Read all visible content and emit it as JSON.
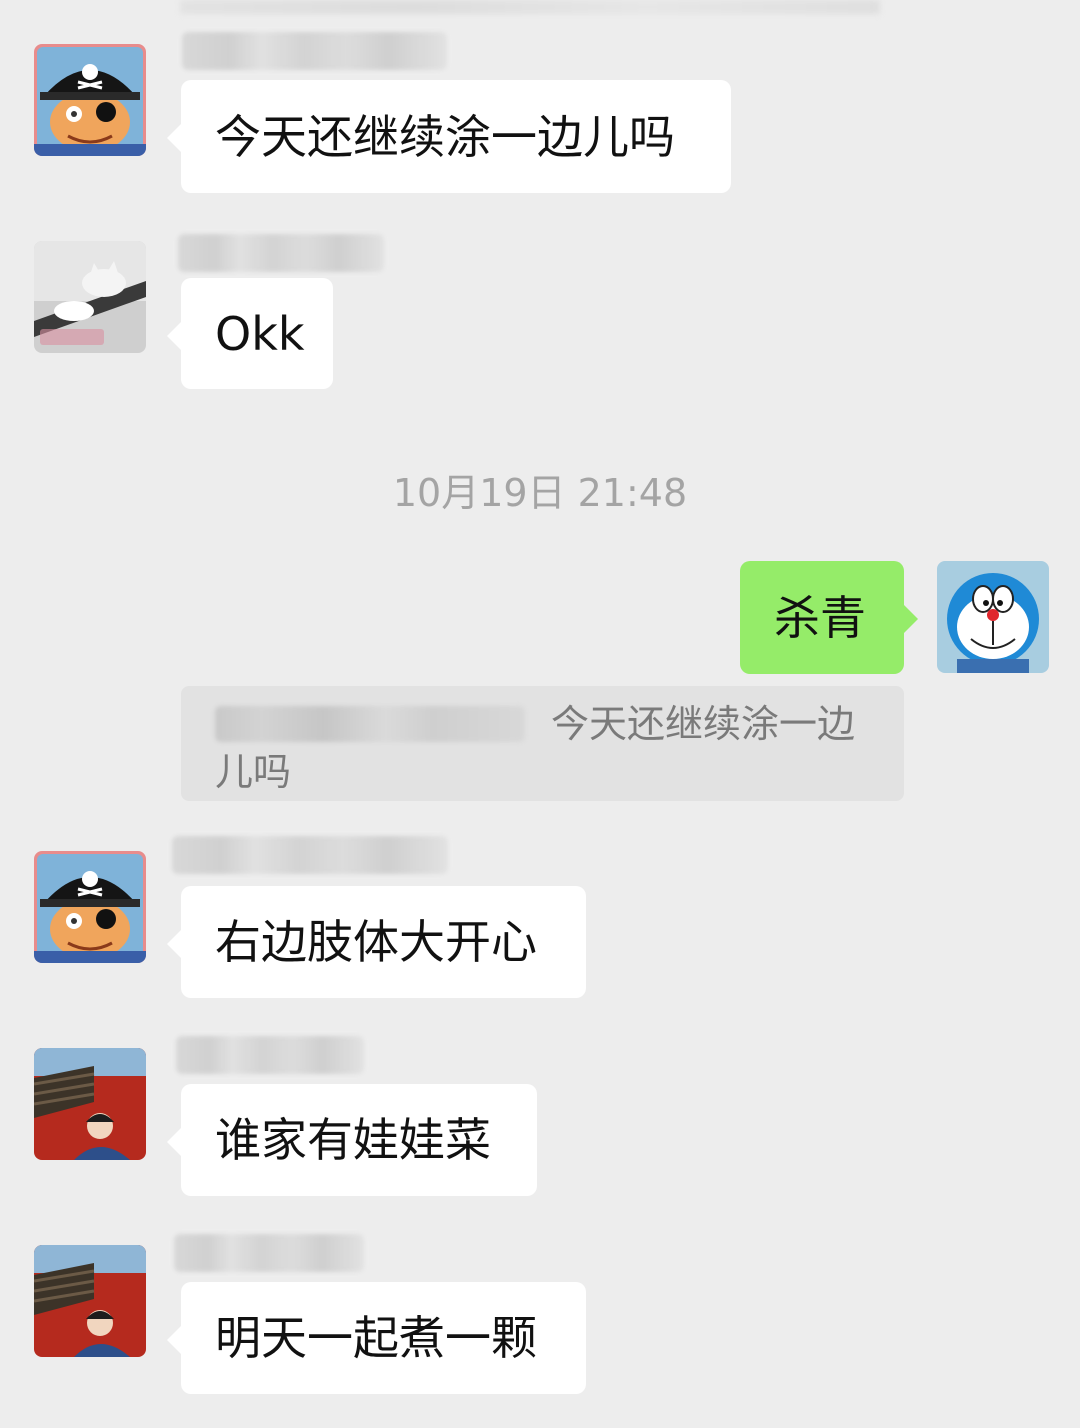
{
  "timestamp": "10月19日 21:48",
  "messages": [
    {
      "text": "今天还继续涂一边儿吗",
      "side": "left",
      "avatar": "pirate-avatar"
    },
    {
      "text": "Okk",
      "side": "left",
      "avatar": "cat-avatar"
    },
    {
      "text": "杀青",
      "side": "right",
      "avatar": "doraemon-avatar"
    },
    {
      "text": "右边肢体大开心",
      "side": "left",
      "avatar": "pirate-avatar"
    },
    {
      "text": "谁家有娃娃菜",
      "side": "left",
      "avatar": "person-wall-avatar"
    },
    {
      "text": "明天一起煮一颗",
      "side": "left",
      "avatar": "person-wall-avatar"
    }
  ],
  "quote": {
    "text": "今天还继续涂一边儿吗"
  },
  "colors": {
    "background": "#ededed",
    "incoming_bubble": "#ffffff",
    "outgoing_bubble": "#95ec69",
    "timestamp_text": "#a4a4a4",
    "quote_bg": "#e2e2e2"
  }
}
